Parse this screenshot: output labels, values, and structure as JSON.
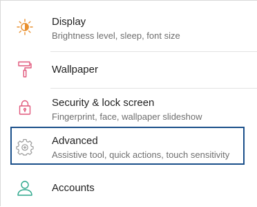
{
  "settings": {
    "items": [
      {
        "title": "Display",
        "subtitle": "Brightness level, sleep, font size",
        "icon": "brightness-icon"
      },
      {
        "title": "Wallpaper",
        "subtitle": "",
        "icon": "paint-roller-icon"
      },
      {
        "title": "Security & lock screen",
        "subtitle": "Fingerprint, face, wallpaper slideshow",
        "icon": "lock-icon"
      },
      {
        "title": "Advanced",
        "subtitle": "Assistive tool, quick actions, touch sensitivity",
        "icon": "advanced-gear-icon"
      },
      {
        "title": "Accounts",
        "subtitle": "",
        "icon": "person-icon"
      }
    ]
  },
  "colors": {
    "accent_orange": "#e9902f",
    "accent_pink": "#e0567a",
    "accent_green": "#2aa68a",
    "accent_gray": "#9a9a9a",
    "highlight_border": "#1a4f8a"
  }
}
